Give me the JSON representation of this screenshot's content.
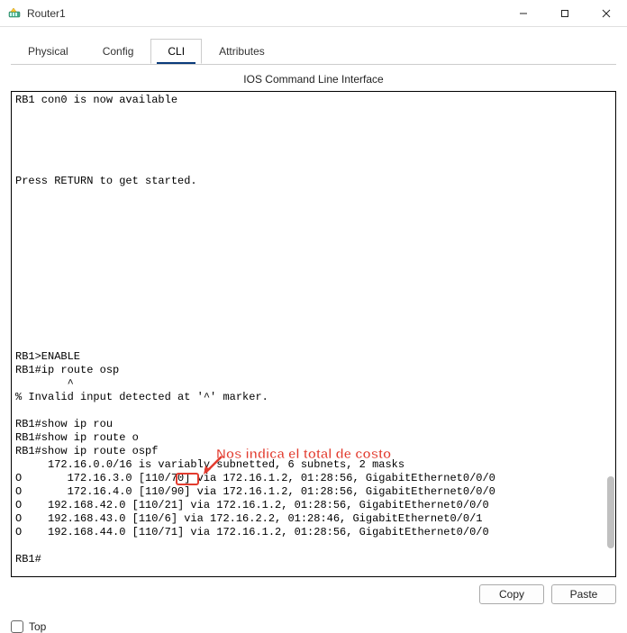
{
  "window": {
    "title": "Router1"
  },
  "tabs": {
    "physical": "Physical",
    "config": "Config",
    "cli": "CLI",
    "attributes": "Attributes"
  },
  "cli": {
    "header": "IOS Command Line Interface",
    "copy": "Copy",
    "paste": "Paste",
    "lines": {
      "l0": "RB1 con0 is now available",
      "l1": "",
      "l2": "",
      "l3": "",
      "l4": "",
      "l5": "",
      "l6": "Press RETURN to get started.",
      "l7": "",
      "l8": "",
      "l9": "",
      "l10": "",
      "l11": "",
      "l12": "",
      "l13": "",
      "l14": "",
      "l15": "",
      "l16": "",
      "l17": "",
      "l18": "",
      "l19": "RB1>ENABLE",
      "l20": "RB1#ip route osp",
      "l21": "        ^",
      "l22": "% Invalid input detected at '^' marker.",
      "l23": "\t",
      "l24": "RB1#show ip rou",
      "l25": "RB1#show ip route o",
      "l26": "RB1#show ip route ospf",
      "l27": "     172.16.0.0/16 is variably subnetted, 6 subnets, 2 masks",
      "l28": "O       172.16.3.0 [110/70] via 172.16.1.2, 01:28:56, GigabitEthernet0/0/0",
      "l29": "O       172.16.4.0 [110/90] via 172.16.1.2, 01:28:56, GigabitEthernet0/0/0",
      "l30": "O    192.168.42.0 [110/21] via 172.16.1.2, 01:28:56, GigabitEthernet0/0/0",
      "l31": "O    192.168.43.0 [110/6] via 172.16.2.2, 01:28:46, GigabitEthernet0/0/1",
      "l32": "O    192.168.44.0 [110/71] via 172.16.1.2, 01:28:56, GigabitEthernet0/0/0",
      "l33": "",
      "l34": "RB1#"
    }
  },
  "annotation": {
    "text": "Nos indica el total de costo"
  },
  "top": {
    "label": "Top"
  }
}
